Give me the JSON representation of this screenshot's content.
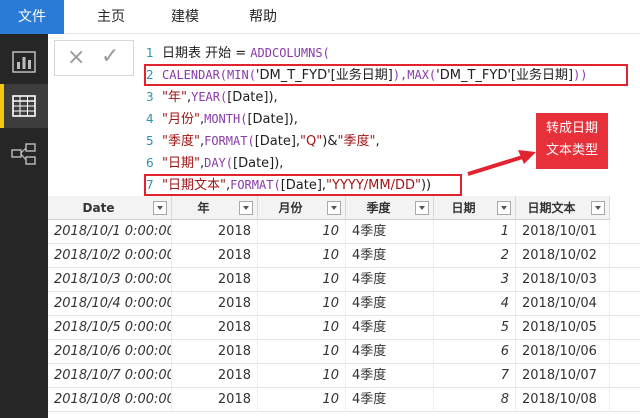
{
  "ribbon": {
    "tabs": [
      "文件",
      "主页",
      "建模",
      "帮助"
    ]
  },
  "formula": {
    "cancel_icon": "×",
    "commit_icon": "✓",
    "lines": [
      {
        "n": "1",
        "parts": [
          {
            "t": "日期表 开始 = ",
            "c": "txt"
          },
          {
            "t": "ADDCOLUMNS(",
            "c": "kw"
          }
        ]
      },
      {
        "n": "2",
        "parts": [
          {
            "t": "CALENDAR(MIN(",
            "c": "kw"
          },
          {
            "t": "'DM_T_FYD'[业务日期]",
            "c": "txt"
          },
          {
            "t": "),MAX(",
            "c": "kw"
          },
          {
            "t": "'DM_T_FYD'[业务日期]",
            "c": "txt"
          },
          {
            "t": "))",
            "c": "kw"
          }
        ]
      },
      {
        "n": "3",
        "parts": [
          {
            "t": "\"年\"",
            "c": "str"
          },
          {
            "t": ",",
            "c": "txt"
          },
          {
            "t": "YEAR(",
            "c": "kw"
          },
          {
            "t": "[Date]),",
            "c": "txt"
          }
        ]
      },
      {
        "n": "4",
        "parts": [
          {
            "t": "\"月份\"",
            "c": "str"
          },
          {
            "t": ",",
            "c": "txt"
          },
          {
            "t": "MONTH(",
            "c": "kw"
          },
          {
            "t": "[Date]),",
            "c": "txt"
          }
        ]
      },
      {
        "n": "5",
        "parts": [
          {
            "t": "\"季度\"",
            "c": "str"
          },
          {
            "t": ",",
            "c": "txt"
          },
          {
            "t": "FORMAT(",
            "c": "kw"
          },
          {
            "t": "[Date],",
            "c": "txt"
          },
          {
            "t": "\"Q\"",
            "c": "str"
          },
          {
            "t": ")&",
            "c": "txt"
          },
          {
            "t": "\"季度\"",
            "c": "str"
          },
          {
            "t": ",",
            "c": "txt"
          }
        ]
      },
      {
        "n": "6",
        "parts": [
          {
            "t": "\"日期\"",
            "c": "str"
          },
          {
            "t": ",",
            "c": "txt"
          },
          {
            "t": "DAY(",
            "c": "kw"
          },
          {
            "t": "[Date]),",
            "c": "txt"
          }
        ]
      },
      {
        "n": "7",
        "parts": [
          {
            "t": "\"日期文本\"",
            "c": "str"
          },
          {
            "t": ",",
            "c": "txt"
          },
          {
            "t": "FORMAT(",
            "c": "kw"
          },
          {
            "t": "[Date],",
            "c": "txt"
          },
          {
            "t": "\"YYYY/MM/DD\"",
            "c": "str"
          },
          {
            "t": "))",
            "c": "txt"
          }
        ]
      }
    ]
  },
  "callout": {
    "line1": "转成日期",
    "line2": "文本类型"
  },
  "colors": {
    "accent": "#2a7bd5",
    "highlight": "#e0232f",
    "active_view": "#f2c811"
  },
  "grid": {
    "columns": [
      "Date",
      "年",
      "月份",
      "季度",
      "日期",
      "日期文本"
    ],
    "rows": [
      [
        "2018/10/1 0:00:00",
        "2018",
        "10",
        "4季度",
        "1",
        "2018/10/01"
      ],
      [
        "2018/10/2 0:00:00",
        "2018",
        "10",
        "4季度",
        "2",
        "2018/10/02"
      ],
      [
        "2018/10/3 0:00:00",
        "2018",
        "10",
        "4季度",
        "3",
        "2018/10/03"
      ],
      [
        "2018/10/4 0:00:00",
        "2018",
        "10",
        "4季度",
        "4",
        "2018/10/04"
      ],
      [
        "2018/10/5 0:00:00",
        "2018",
        "10",
        "4季度",
        "5",
        "2018/10/05"
      ],
      [
        "2018/10/6 0:00:00",
        "2018",
        "10",
        "4季度",
        "6",
        "2018/10/06"
      ],
      [
        "2018/10/7 0:00:00",
        "2018",
        "10",
        "4季度",
        "7",
        "2018/10/07"
      ],
      [
        "2018/10/8 0:00:00",
        "2018",
        "10",
        "4季度",
        "8",
        "2018/10/08"
      ]
    ]
  }
}
